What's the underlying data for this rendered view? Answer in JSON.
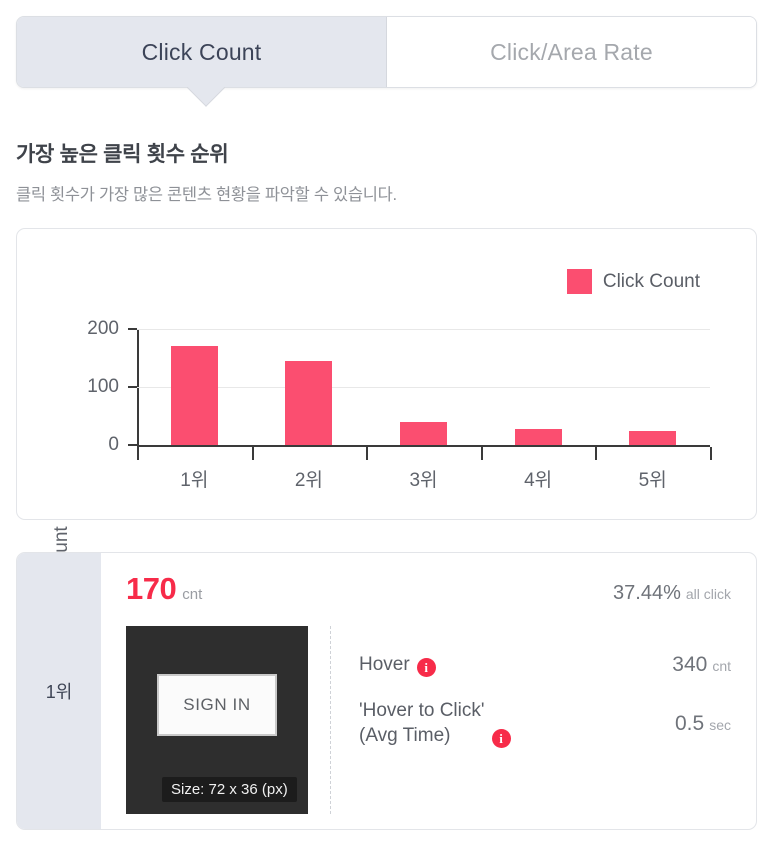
{
  "tabs": [
    {
      "label": "Click Count",
      "active": true
    },
    {
      "label": "Click/Area Rate",
      "active": false
    }
  ],
  "section": {
    "title": "가장 높은 클릭 횟수 순위",
    "subtitle": "클릭 횟수가 가장 많은 콘텐츠 현황을 파악할 수 있습니다."
  },
  "colors": {
    "bar": "#fb4e70",
    "accent_red": "#f72b49",
    "active_tab_bg": "#e4e7ee",
    "card_border": "#e3e5e9"
  },
  "chart_data": {
    "type": "bar",
    "title": "",
    "xlabel": "",
    "ylabel": "Count",
    "categories": [
      "1위",
      "2위",
      "3위",
      "4위",
      "5위"
    ],
    "values": [
      170,
      145,
      40,
      28,
      24
    ],
    "series": [
      {
        "name": "Click Count",
        "values": [
          170,
          145,
          40,
          28,
          24
        ]
      }
    ],
    "ylim": [
      0,
      200
    ],
    "yticks": [
      0,
      100,
      200
    ],
    "ytick_labels": [
      "0",
      "100",
      "200"
    ],
    "grid": true,
    "legend": {
      "position": "top-right",
      "entries": [
        "Click Count"
      ]
    }
  },
  "rank_card": {
    "rank_label": "1위",
    "count_value": "170",
    "count_unit": "cnt",
    "percent_value": "37.44%",
    "percent_unit": "all click",
    "thumbnail": {
      "button_text": "SIGN IN",
      "size_caption": "Size: 72 x 36 (px)"
    },
    "metrics": [
      {
        "label_line1": "Hover",
        "label_line2": "",
        "value": "340",
        "unit": "cnt",
        "has_info": true
      },
      {
        "label_line1": "'Hover to Click'",
        "label_line2": "(Avg Time)",
        "value": "0.5",
        "unit": "sec",
        "has_info": true
      }
    ]
  }
}
